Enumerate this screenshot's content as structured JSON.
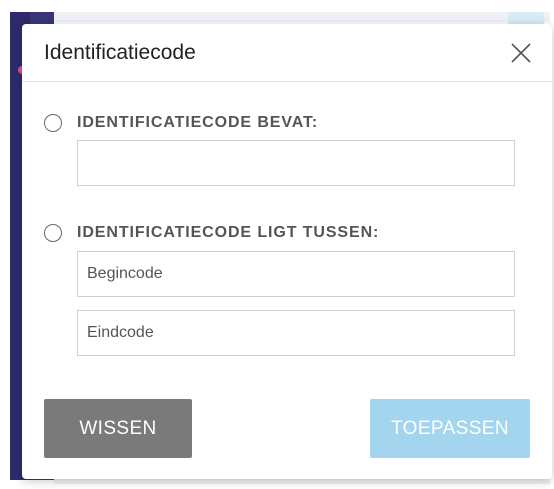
{
  "dialog": {
    "title": "Identificatiecode",
    "close_icon": "close-icon"
  },
  "option_contains": {
    "label": "IDENTIFICATIECODE BEVAT:",
    "selected": false,
    "input": {
      "value": "",
      "placeholder": ""
    }
  },
  "option_between": {
    "label": "IDENTIFICATIECODE LIGT TUSSEN:",
    "selected": false,
    "start_input": {
      "value": "",
      "placeholder": "Begincode"
    },
    "end_input": {
      "value": "",
      "placeholder": "Eindcode"
    }
  },
  "buttons": {
    "clear_label": "WISSEN",
    "apply_label": "TOEPASSEN"
  },
  "colors": {
    "clear_button": "#7a7a7a",
    "apply_button": "#a3d5ee",
    "sidebar": "#2f2a6b"
  }
}
